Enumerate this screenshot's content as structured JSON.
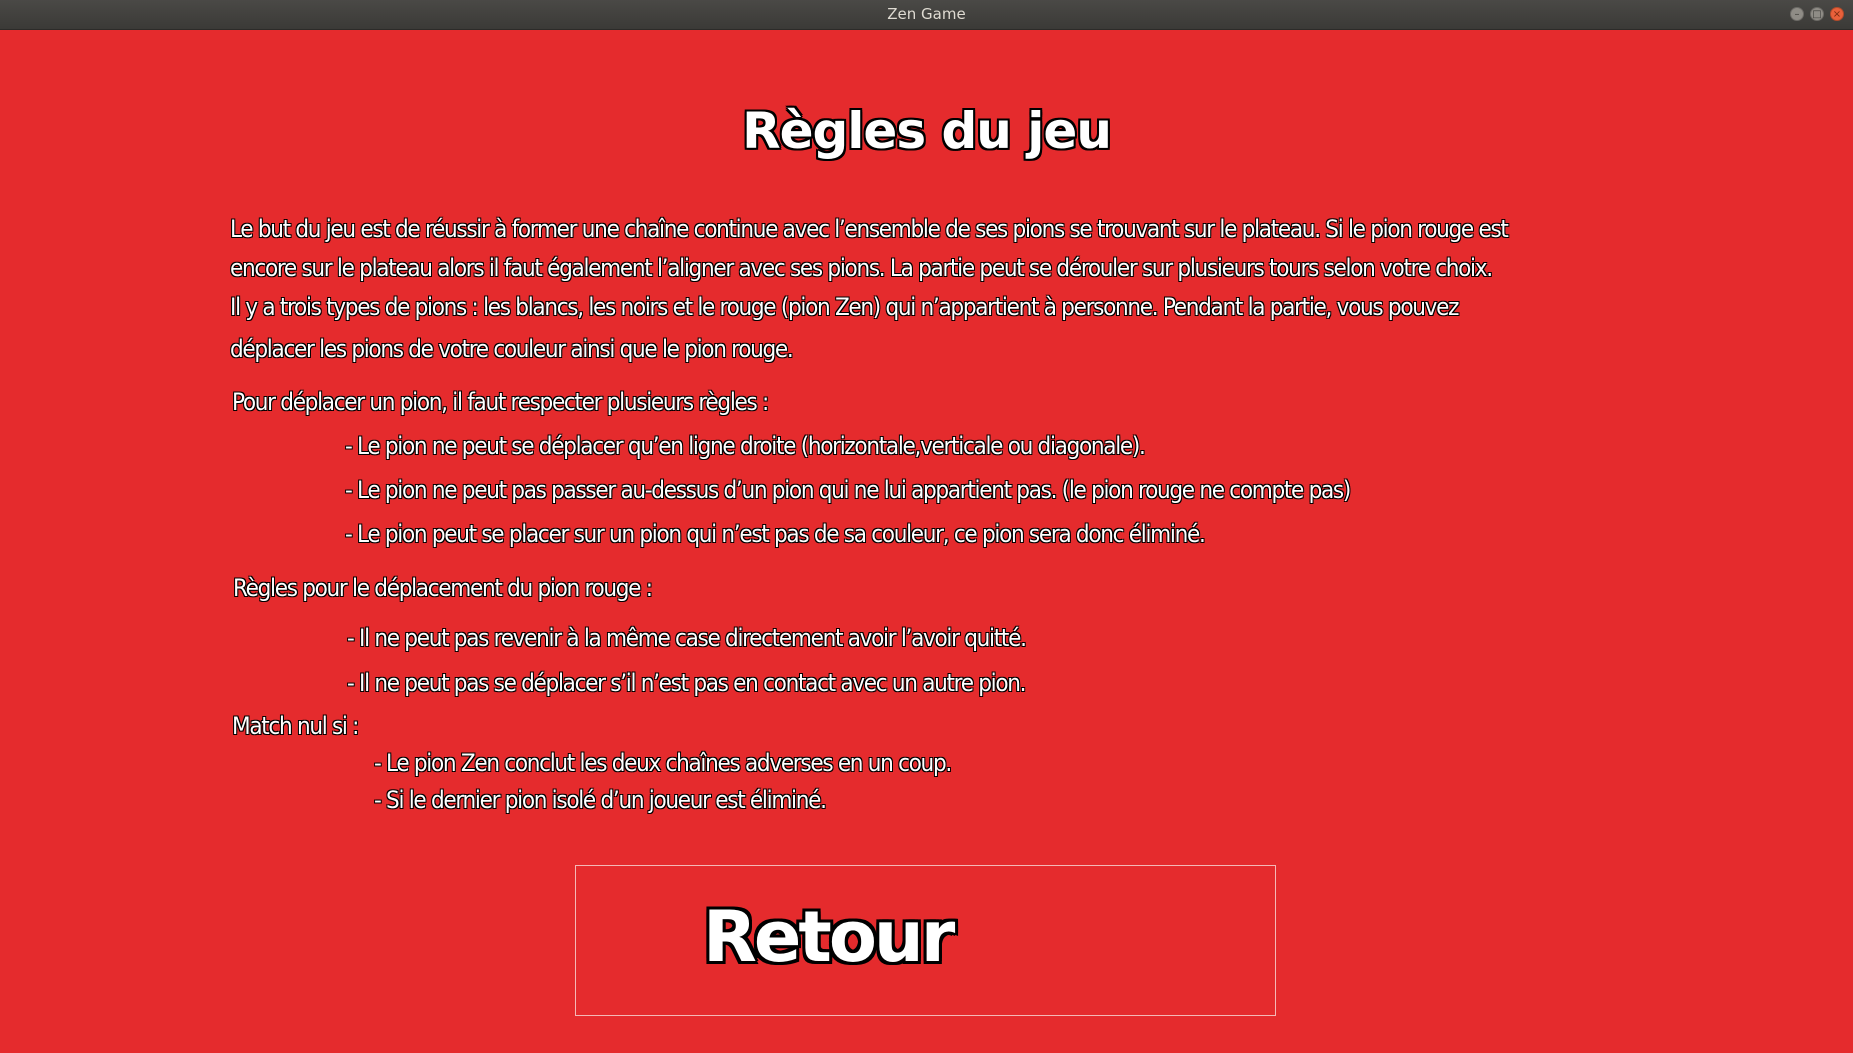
{
  "window": {
    "title": "Zen Game",
    "controls": [
      "minimize",
      "maximize",
      "close"
    ]
  },
  "rules": {
    "title": "Règles du jeu",
    "intro": [
      "Le but du jeu est de réussir à former une chaîne continue avec l’ensemble de ses pions se trouvant sur le plateau. Si le pion rouge est",
      "encore sur le plateau alors il faut également l’aligner avec ses pions. La partie peut se dérouler sur plusieurs tours selon votre choix.",
      "Il y a trois types de pions : les blancs, les noirs et le rouge (pion Zen) qui n’appartient à personne. Pendant la partie, vous pouvez",
      "déplacer les pions de votre couleur ainsi que le pion rouge."
    ],
    "move_heading": "Pour déplacer un pion, il faut respecter plusieurs règles :",
    "move_rules": [
      "- Le pion ne peut se déplacer qu’en ligne droite (horizontale,verticale ou diagonale).",
      "- Le pion ne peut pas passer au-dessus d’un pion qui ne lui appartient pas. (le pion rouge ne compte pas)",
      "- Le pion peut se placer sur un pion qui n’est pas de sa couleur, ce pion sera donc éliminé."
    ],
    "red_heading": "Règles pour le déplacement du pion rouge :",
    "red_rules": [
      "- Il ne peut pas revenir à la même case directement avoir l’avoir quitté.",
      "- Il ne peut pas se déplacer s’il n’est pas en contact avec un autre pion."
    ],
    "draw_heading": "Match nul si :",
    "draw_rules": [
      "- Le pion Zen conclut les deux chaînes adverses en un coup.",
      "- Si le dernier pion isolé d’un joueur est éliminé."
    ]
  },
  "buttons": {
    "back_label": "Retour"
  },
  "colors": {
    "background": "#e52b2d",
    "text": "#ffffff",
    "outline": "#000000"
  }
}
